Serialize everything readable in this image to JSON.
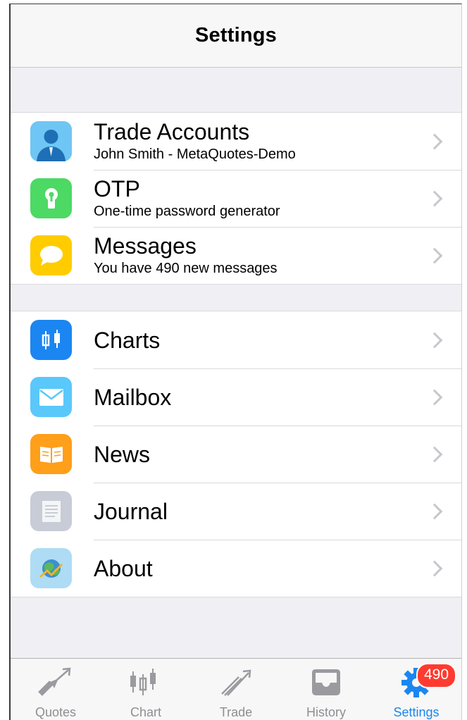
{
  "nav": {
    "title": "Settings"
  },
  "group1": [
    {
      "title": "Trade Accounts",
      "subtitle": "John  Smith - MetaQuotes-Demo",
      "icon": "user-icon"
    },
    {
      "title": "OTP",
      "subtitle": "One-time password generator",
      "icon": "keyhole-icon"
    },
    {
      "title": "Messages",
      "subtitle": "You have 490 new messages",
      "icon": "speech-bubble-icon"
    }
  ],
  "group2": [
    {
      "title": "Charts",
      "icon": "candlestick-icon"
    },
    {
      "title": "Mailbox",
      "icon": "envelope-icon"
    },
    {
      "title": "News",
      "icon": "book-icon"
    },
    {
      "title": "Journal",
      "icon": "document-icon"
    },
    {
      "title": "About",
      "icon": "metatrader-icon"
    }
  ],
  "tabs": [
    {
      "label": "Quotes",
      "icon": "arrows-icon"
    },
    {
      "label": "Chart",
      "icon": "candlestick-icon"
    },
    {
      "label": "Trade",
      "icon": "trend-icon"
    },
    {
      "label": "History",
      "icon": "inbox-icon"
    },
    {
      "label": "Settings",
      "icon": "gear-icon",
      "active": true,
      "badge": "490"
    }
  ],
  "colors": {
    "accent": "#1b86f1",
    "badge": "#ff3b30"
  }
}
